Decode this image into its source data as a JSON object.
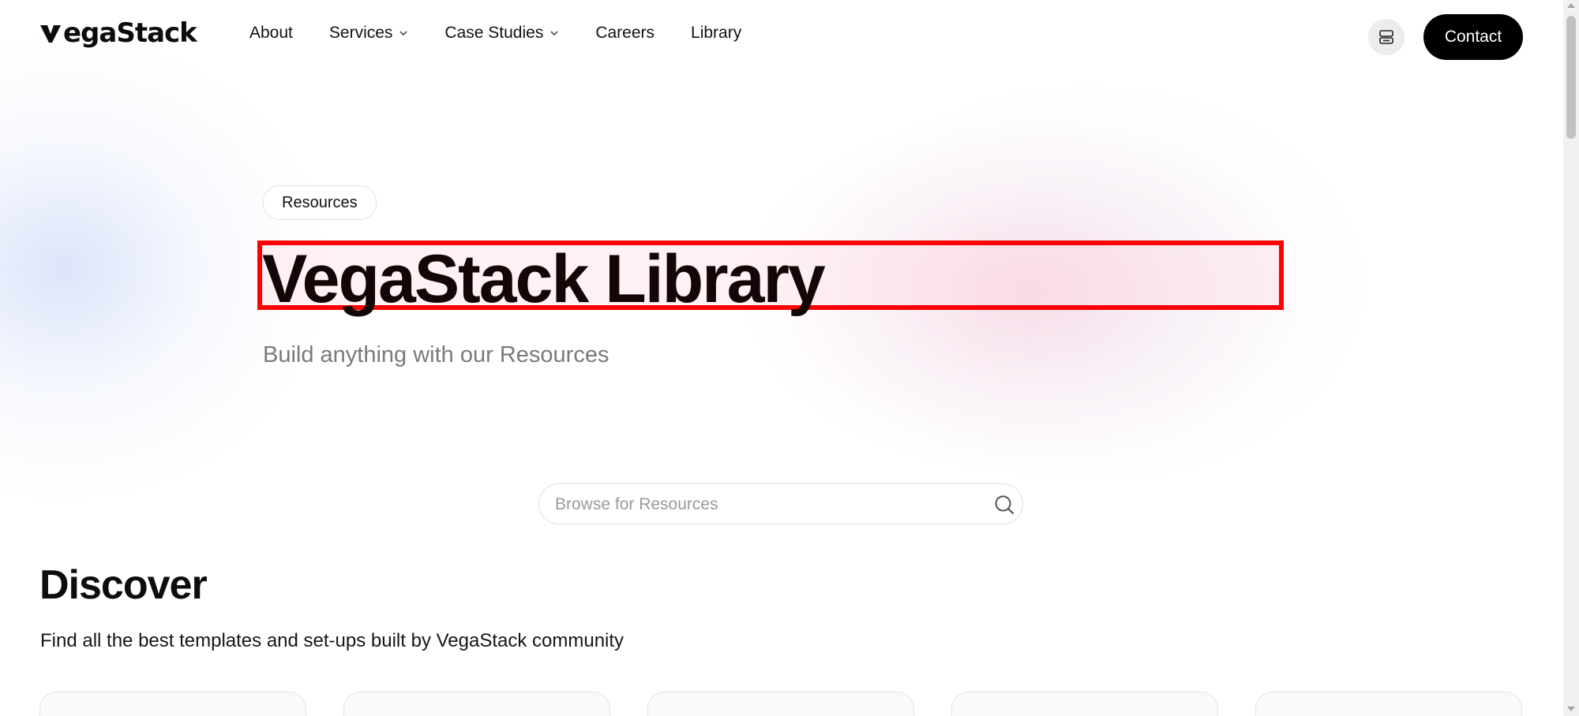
{
  "header": {
    "logo_text": "VegaStack",
    "nav": [
      {
        "label": "About",
        "dropdown": false
      },
      {
        "label": "Services",
        "dropdown": true
      },
      {
        "label": "Case Studies",
        "dropdown": true
      },
      {
        "label": "Careers",
        "dropdown": false
      },
      {
        "label": "Library",
        "dropdown": false
      }
    ],
    "theme_icon": "server-icon",
    "contact_label": "Contact"
  },
  "hero": {
    "badge": "Resources",
    "title": "VegaStack Library",
    "subtitle": "Build anything with our Resources"
  },
  "search": {
    "placeholder": "Browse for Resources",
    "value": ""
  },
  "discover": {
    "title": "Discover",
    "subtitle": "Find all the best templates and set-ups built by VegaStack community",
    "cards_visible": 5
  },
  "colors": {
    "accent": "#000000",
    "highlight_border": "#ff0000",
    "subtitle_gray": "#7a7a7a"
  }
}
